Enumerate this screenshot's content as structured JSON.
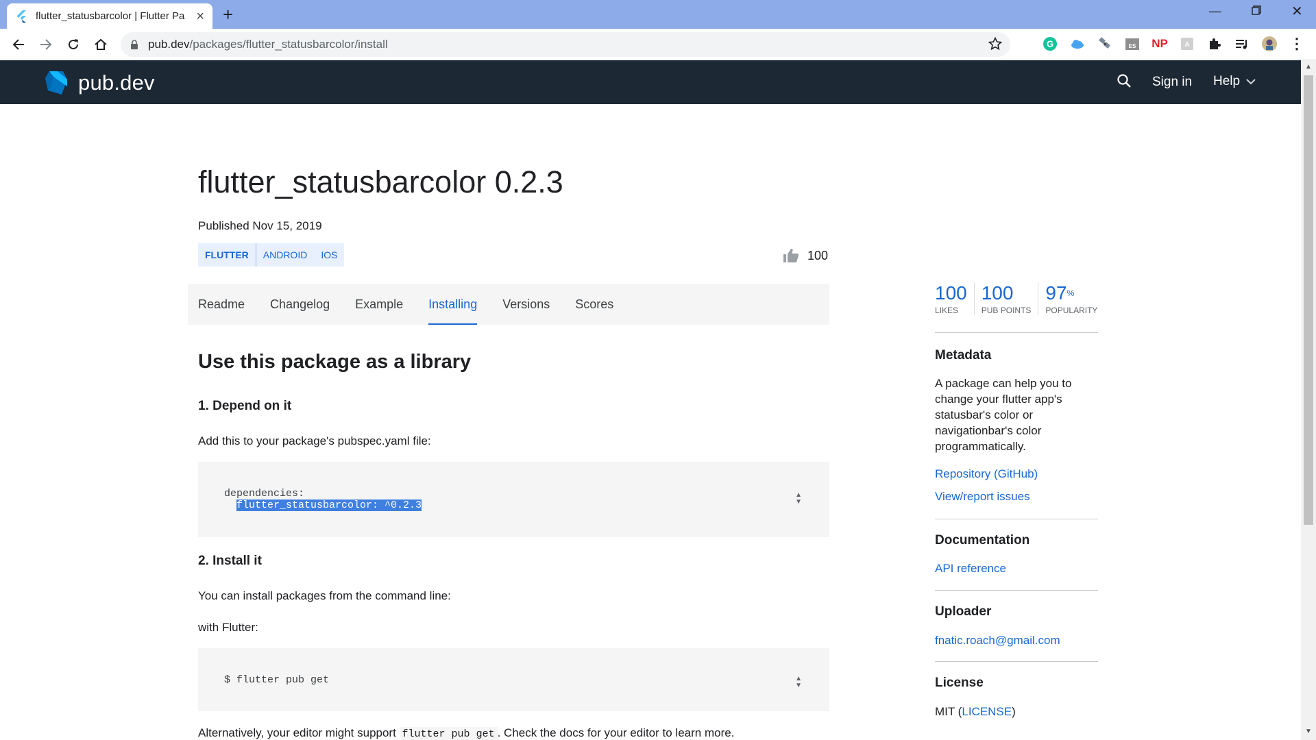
{
  "browser": {
    "tab_title": "flutter_statusbarcolor | Flutter Pa",
    "url_host": "pub.dev",
    "url_path": "/packages/flutter_statusbarcolor/install",
    "extensions": [
      "grammarly-icon",
      "cloud-icon",
      "satellite-icon",
      "es-icon",
      "np-icon",
      "translate-icon",
      "puzzle-icon",
      "playlist-icon",
      "profile-avatar"
    ],
    "ext_labels": {
      "np": "NP",
      "es": "ES"
    }
  },
  "site": {
    "logo_text": "pub.dev",
    "signin": "Sign in",
    "help": "Help"
  },
  "package": {
    "title": "flutter_statusbarcolor 0.2.3",
    "published": "Published Nov 15, 2019",
    "tags": [
      "FLUTTER",
      "ANDROID",
      "IOS"
    ],
    "likes": "100"
  },
  "tabs": [
    "Readme",
    "Changelog",
    "Example",
    "Installing",
    "Versions",
    "Scores"
  ],
  "active_tab": "Installing",
  "install": {
    "heading": "Use this package as a library",
    "step1": "1. Depend on it",
    "step1_text": "Add this to your package's pubspec.yaml file:",
    "code1_line1": "dependencies:",
    "code1_line2": "flutter_statusbarcolor: ^0.2.3",
    "step2": "2. Install it",
    "step2_text": "You can install packages from the command line:",
    "with_flutter": "with Flutter:",
    "code2": "$ flutter pub get",
    "alt_before": "Alternatively, your editor might support ",
    "alt_code": "flutter pub get",
    "alt_after": ". Check the docs for your editor to learn more."
  },
  "sidebar": {
    "stats": [
      {
        "num": "100",
        "label": "LIKES"
      },
      {
        "num": "100",
        "label": "PUB POINTS"
      },
      {
        "num": "97",
        "suffix": "%",
        "label": "POPULARITY"
      }
    ],
    "metadata_title": "Metadata",
    "description": "A package can help you to change your flutter app's statusbar's color or navigationbar's color programmatically.",
    "repository": "Repository (GitHub)",
    "issues": "View/report issues",
    "documentation_title": "Documentation",
    "api_reference": "API reference",
    "uploader_title": "Uploader",
    "uploader_email": "fnatic.roach@gmail.com",
    "license_title": "License",
    "license_prefix": "MIT (",
    "license_link": "LICENSE",
    "license_suffix": ")"
  },
  "colors": {
    "browser_tabbar": "#8dabe8",
    "site_header": "#1c2834",
    "link": "#1967d2"
  }
}
